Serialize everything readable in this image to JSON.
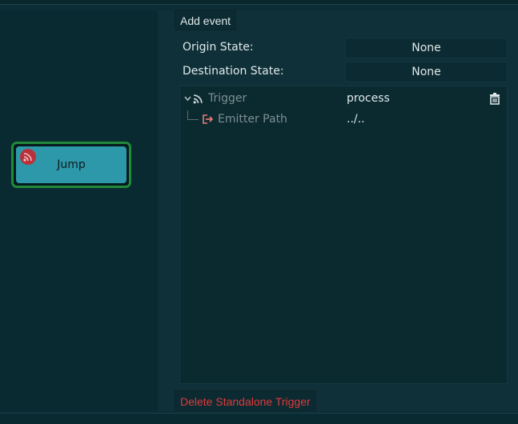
{
  "graph": {
    "node": {
      "label": "Jump",
      "badge_icon": "rss-icon",
      "border_color": "#1f8a3a",
      "fill_color": "#2d98a9"
    }
  },
  "panel": {
    "add_event_label": "Add event",
    "origin_state_label": "Origin State:",
    "origin_state_value": "None",
    "destination_state_label": "Destination State:",
    "destination_state_value": "None",
    "tree": {
      "trigger_label": "Trigger",
      "trigger_value": "process",
      "trigger_icon": "rss-icon",
      "delete_icon": "trash-icon",
      "emitter_label": "Emitter Path",
      "emitter_value": "../..",
      "emitter_icon": "export-icon"
    },
    "delete_label": "Delete Standalone Trigger"
  },
  "colors": {
    "accent_red": "#e03a3a",
    "background": "#0c2d35"
  }
}
